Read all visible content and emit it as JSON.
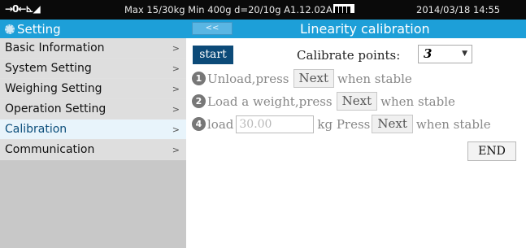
{
  "status_bar": {
    "zero_indicator": "→0←⊾◢",
    "info": "Max 15/30kg  Min 400g  d=20/10g   A1.12.02A",
    "datetime": "2014/03/18  14:55"
  },
  "sidebar": {
    "title": "Setting",
    "items": [
      {
        "label": "Basic Information",
        "chevron": ">"
      },
      {
        "label": "System Setting",
        "chevron": ">"
      },
      {
        "label": "Weighing Setting",
        "chevron": ">"
      },
      {
        "label": "Operation Setting",
        "chevron": ">"
      },
      {
        "label": "Calibration",
        "chevron": ">"
      },
      {
        "label": "Communication",
        "chevron": ">"
      }
    ]
  },
  "header": {
    "back_label": "<<",
    "title": "Linearity calibration"
  },
  "content": {
    "start_label": "start",
    "calibrate_points_label": "Calibrate points:",
    "calibrate_points_value": "3",
    "steps": [
      {
        "num": "1",
        "prefix": "Unload,press",
        "button": "Next",
        "suffix": "when stable"
      },
      {
        "num": "2",
        "prefix": "Load a weight,press",
        "button": "Next",
        "suffix": "when stable"
      },
      {
        "num": "4",
        "prefix": "load",
        "input_value": "30.00",
        "unit_text": "kg Press",
        "button": "Next",
        "suffix": "when stable"
      }
    ],
    "end_label": "END"
  }
}
